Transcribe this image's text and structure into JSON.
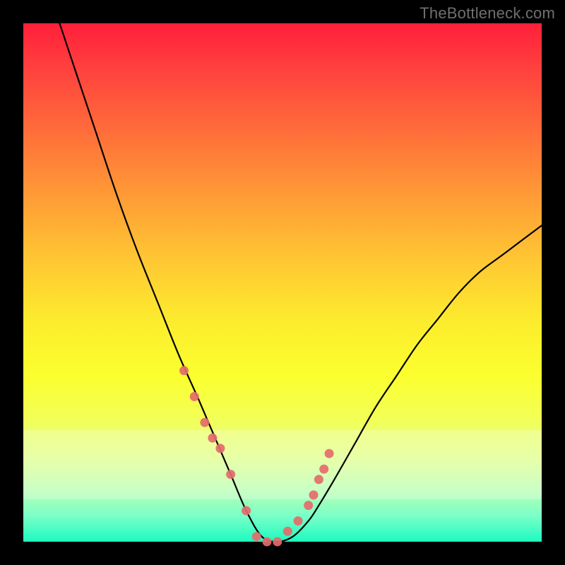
{
  "watermark": "TheBottleneck.com",
  "colors": {
    "marker": "#e46b6b",
    "curve": "#000000"
  },
  "chart_data": {
    "type": "line",
    "title": "",
    "xlabel": "",
    "ylabel": "",
    "xlim": [
      0,
      100
    ],
    "ylim": [
      0,
      100
    ],
    "description": "Bottleneck V-curve with minimum near x≈45. Y is percentage bottleneck (0 = ideal, 100 = severe). Gradient background encodes severity (green low → red high).",
    "series": [
      {
        "name": "bottleneck-curve",
        "x": [
          7,
          10,
          14,
          18,
          22,
          26,
          30,
          34,
          37,
          40,
          43,
          46,
          49,
          52,
          55,
          57,
          60,
          64,
          68,
          72,
          76,
          80,
          84,
          88,
          92,
          96,
          100
        ],
        "y": [
          100,
          91,
          79,
          67,
          56,
          46,
          36,
          27,
          20,
          13,
          6,
          1,
          0,
          1,
          4,
          7,
          12,
          19,
          26,
          32,
          38,
          43,
          48,
          52,
          55,
          58,
          61
        ]
      }
    ],
    "markers": {
      "name": "sample-points",
      "x": [
        31,
        33,
        35,
        36.5,
        38,
        40,
        43,
        45,
        47,
        49,
        51,
        53,
        55,
        56,
        57,
        58,
        59
      ],
      "y": [
        33,
        28,
        23,
        20,
        18,
        13,
        6,
        1,
        0,
        0,
        2,
        4,
        7,
        9,
        12,
        14,
        17
      ]
    },
    "bands": [
      {
        "y_from": 13,
        "y_to": 21,
        "note": "pale acceptable zone upper"
      },
      {
        "y_from": 8,
        "y_to": 13,
        "note": "pale acceptable zone mid"
      }
    ]
  }
}
